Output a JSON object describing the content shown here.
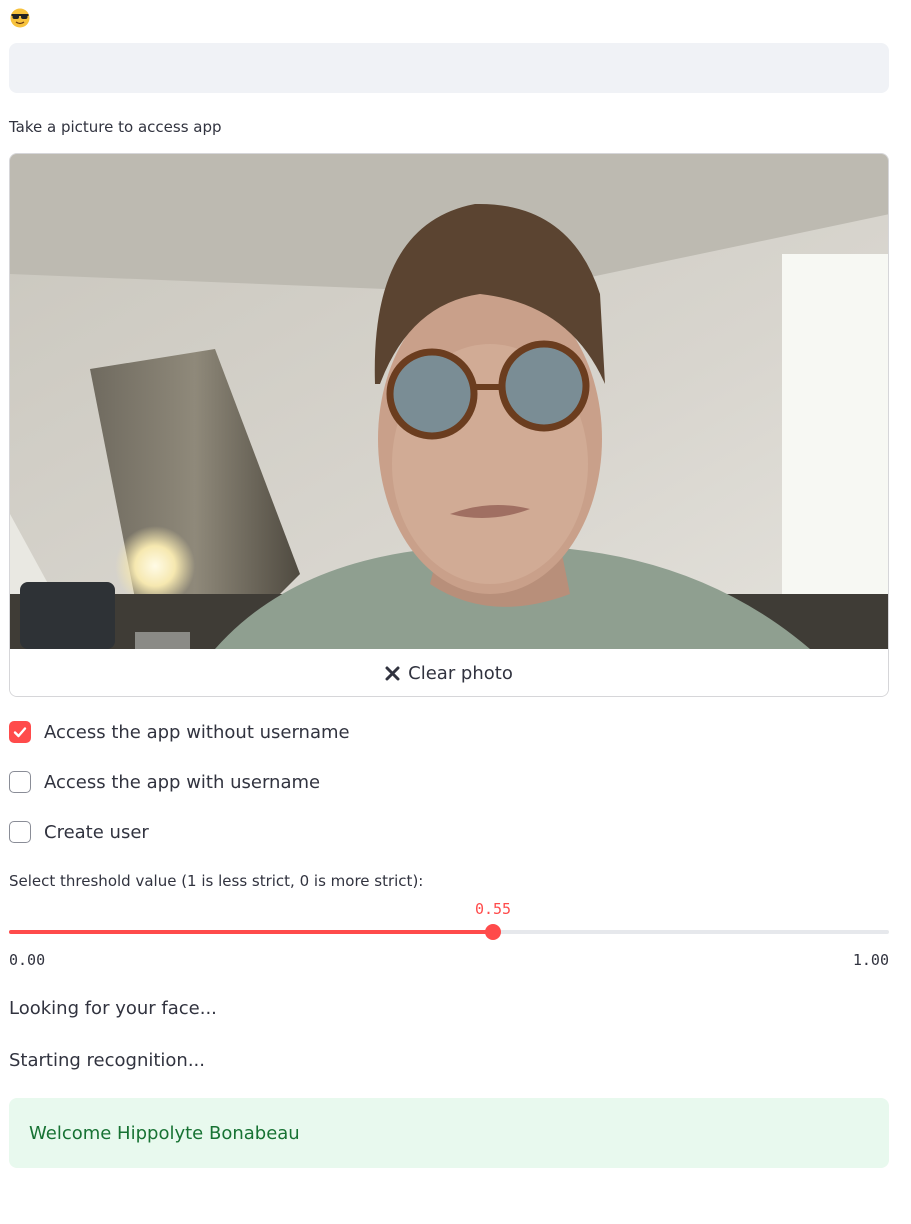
{
  "header": {
    "emoji_icon": "sunglasses-face-icon"
  },
  "top_input": {
    "value": ""
  },
  "camera": {
    "label": "Take a picture to access app",
    "clear_button_label": "Clear photo",
    "clear_icon": "close-icon"
  },
  "checkboxes": [
    {
      "label": "Access the app without username",
      "checked": true
    },
    {
      "label": "Access the app with username",
      "checked": false
    },
    {
      "label": "Create user",
      "checked": false
    }
  ],
  "slider": {
    "label": "Select threshold value (1 is less strict, 0 is more strict):",
    "value": 0.55,
    "value_text": "0.55",
    "min": 0,
    "max": 1,
    "min_text": "0.00",
    "max_text": "1.00",
    "accent_color": "#ff4b4b"
  },
  "status": {
    "line1": "Looking for your face...",
    "line2": "Starting recognition..."
  },
  "alert": {
    "text": "Welcome Hippolyte Bonabeau",
    "color": "#177233",
    "background": "#e8f9ee"
  }
}
